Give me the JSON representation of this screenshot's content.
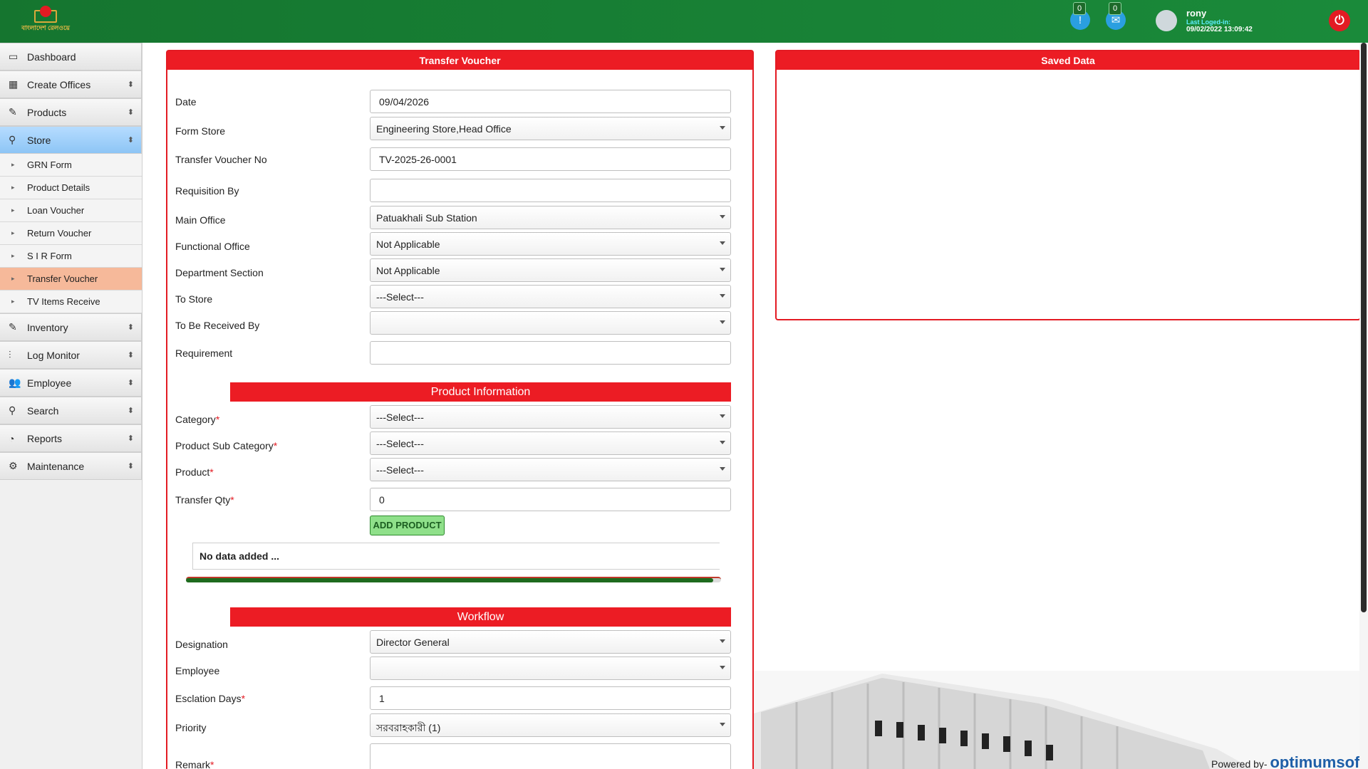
{
  "header": {
    "logo_text": "বাংলাদেশ রেলওয়ে",
    "notifications": [
      {
        "count": "0",
        "icon": "alert-icon"
      },
      {
        "count": "0",
        "icon": "mail-icon"
      }
    ],
    "user": {
      "name": "rony",
      "last_logged_label": "Last Loged-in:",
      "last_logged_time": "09/02/2022 13:09:42"
    }
  },
  "sidebar": {
    "items": [
      {
        "label": "Dashboard",
        "icon": "monitor-icon",
        "expandable": false
      },
      {
        "label": "Create Offices",
        "icon": "building-icon",
        "expandable": true
      },
      {
        "label": "Products",
        "icon": "pen-icon",
        "expandable": true
      },
      {
        "label": "Store",
        "icon": "search-icon",
        "expandable": true,
        "active": true
      },
      {
        "label": "Inventory",
        "icon": "pen-icon",
        "expandable": true
      },
      {
        "label": "Log Monitor",
        "icon": "sliders-icon",
        "expandable": true
      },
      {
        "label": "Employee",
        "icon": "users-icon",
        "expandable": true
      },
      {
        "label": "Search",
        "icon": "search-icon",
        "expandable": true
      },
      {
        "label": "Reports",
        "icon": "pie-icon",
        "expandable": true
      },
      {
        "label": "Maintenance",
        "icon": "gear-icon",
        "expandable": true
      }
    ],
    "store_sub": [
      "GRN Form",
      "Product Details",
      "Loan Voucher",
      "Return Voucher",
      "S I R Form",
      "Transfer Voucher",
      "TV Items Receive"
    ],
    "active_sub": "Transfer Voucher"
  },
  "transfer_voucher": {
    "title": "Transfer Voucher",
    "fields": {
      "date": {
        "label": "Date",
        "value": "09/04/2026"
      },
      "form_store": {
        "label": "Form Store",
        "value": "Engineering Store,Head Office"
      },
      "voucher_no": {
        "label": "Transfer Voucher No",
        "value": "TV-2025-26-0001"
      },
      "requisition_by": {
        "label": "Requisition By",
        "value": ""
      },
      "main_office": {
        "label": "Main Office",
        "value": "Patuakhali Sub Station"
      },
      "functional_office": {
        "label": "Functional Office",
        "value": "Not Applicable"
      },
      "department_section": {
        "label": "Department Section",
        "value": "Not Applicable"
      },
      "to_store": {
        "label": "To Store",
        "value": "---Select---"
      },
      "to_be_received_by": {
        "label": "To Be Received By",
        "value": ""
      },
      "requirement": {
        "label": "Requirement",
        "value": ""
      }
    },
    "product_info": {
      "title": "Product Information",
      "category": {
        "label": "Category",
        "value": "---Select---"
      },
      "sub_category": {
        "label": "Product Sub Category",
        "value": "---Select---"
      },
      "product": {
        "label": "Product",
        "value": "---Select---"
      },
      "transfer_qty": {
        "label": "Transfer Qty",
        "value": "0"
      },
      "add_button": "ADD PRODUCT",
      "empty_text": "No data added ..."
    },
    "workflow": {
      "title": "Workflow",
      "designation": {
        "label": "Designation",
        "value": "Director General"
      },
      "employee": {
        "label": "Employee",
        "value": ""
      },
      "escalation_days": {
        "label": "Esclation Days",
        "value": "1"
      },
      "priority": {
        "label": "Priority",
        "value": "সরবরাহকারী (1)"
      },
      "remark": {
        "label": "Remark",
        "value": ""
      }
    },
    "required_mark": "*"
  },
  "saved_data": {
    "title": "Saved Data"
  },
  "footer": {
    "powered_by": "Powered by-",
    "brand": "optimumsoft"
  },
  "colors": {
    "header_green": "#1a8a3a",
    "accent_red": "#ec1c24",
    "active_sub": "#f6b99a",
    "active_menu": "#9fd0f8"
  }
}
